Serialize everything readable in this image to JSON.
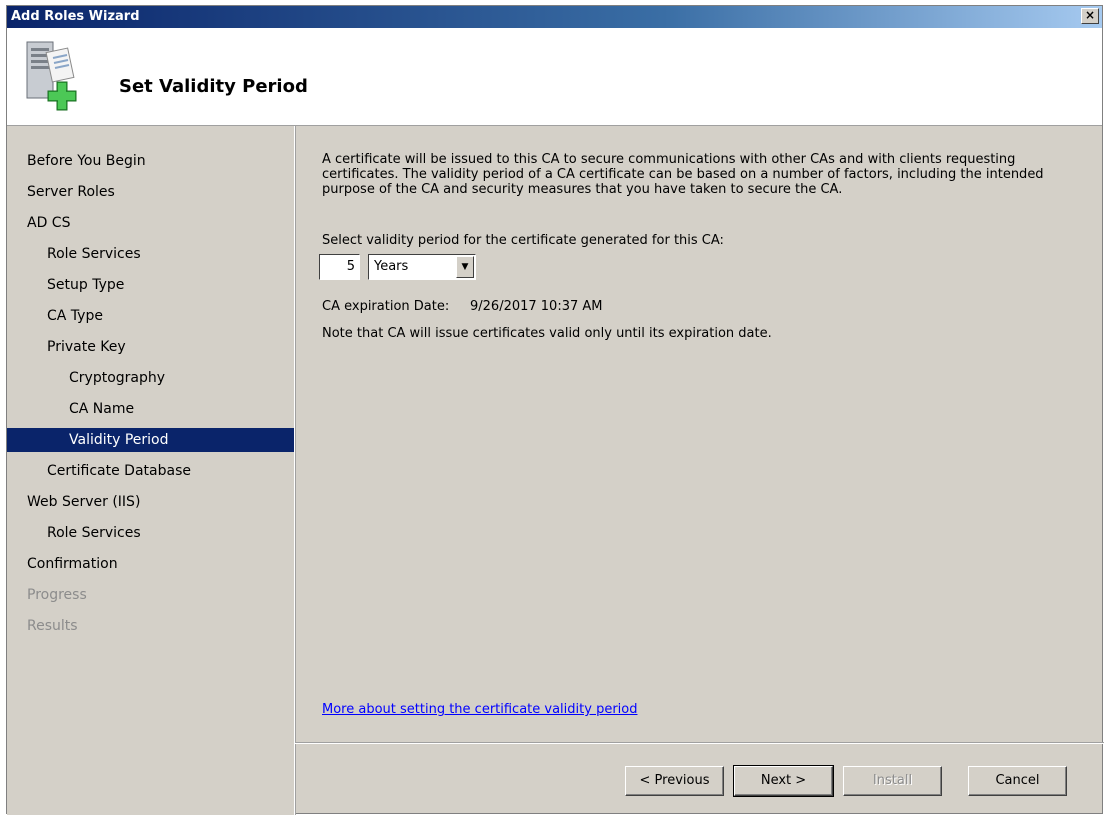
{
  "window": {
    "title": "Add Roles Wizard",
    "close_glyph": "×"
  },
  "header": {
    "title": "Set Validity Period",
    "icon": "server-add-icon"
  },
  "nav": {
    "items": [
      {
        "label": "Before You Begin",
        "level": 0,
        "state": "normal"
      },
      {
        "label": "Server Roles",
        "level": 0,
        "state": "normal"
      },
      {
        "label": "AD CS",
        "level": 0,
        "state": "normal"
      },
      {
        "label": "Role Services",
        "level": 1,
        "state": "normal"
      },
      {
        "label": "Setup Type",
        "level": 1,
        "state": "normal"
      },
      {
        "label": "CA Type",
        "level": 1,
        "state": "normal"
      },
      {
        "label": "Private Key",
        "level": 1,
        "state": "normal"
      },
      {
        "label": "Cryptography",
        "level": 2,
        "state": "normal"
      },
      {
        "label": "CA Name",
        "level": 2,
        "state": "normal"
      },
      {
        "label": "Validity Period",
        "level": 2,
        "state": "selected"
      },
      {
        "label": "Certificate Database",
        "level": 1,
        "state": "normal"
      },
      {
        "label": "Web Server (IIS)",
        "level": 0,
        "state": "normal"
      },
      {
        "label": "Role Services",
        "level": 1,
        "state": "normal"
      },
      {
        "label": "Confirmation",
        "level": 0,
        "state": "normal"
      },
      {
        "label": "Progress",
        "level": 0,
        "state": "disabled"
      },
      {
        "label": "Results",
        "level": 0,
        "state": "disabled"
      }
    ]
  },
  "main": {
    "description": "A certificate will be issued to this CA to secure communications with other CAs and with clients requesting certificates. The validity period of a CA certificate can be based on a number of factors, including the intended purpose of the CA and security measures that you have taken to secure the CA.",
    "select_label": "Select validity period for the certificate generated for this CA:",
    "validity_value": "5",
    "validity_unit": "Years",
    "expiration_label": "CA expiration Date:",
    "expiration_value": "9/26/2017 10:37 AM",
    "note": "Note that CA will issue certificates valid only until its expiration date.",
    "help_link": "More about setting the certificate validity period"
  },
  "buttons": {
    "previous": "< Previous",
    "next": "Next >",
    "install": "Install",
    "cancel": "Cancel"
  }
}
